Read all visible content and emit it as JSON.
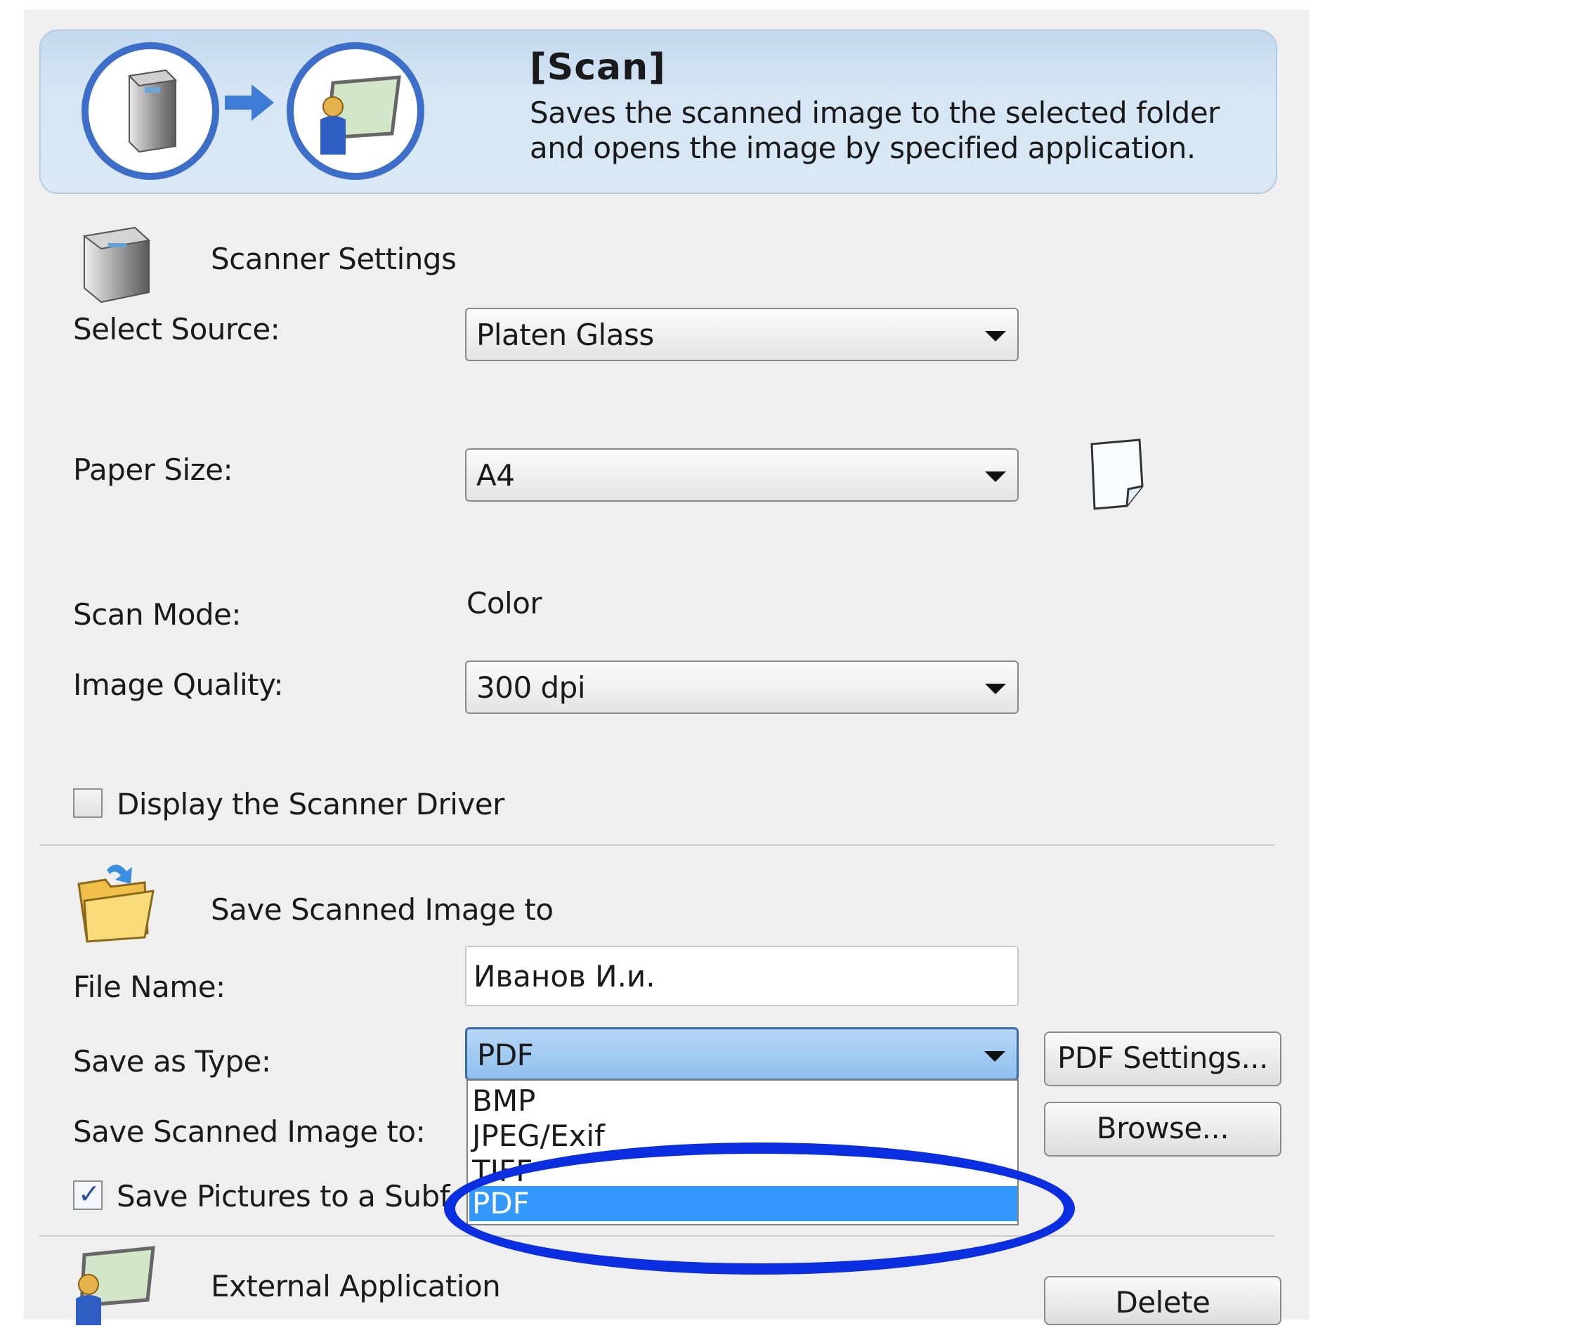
{
  "header": {
    "title": "[Scan]",
    "description_line1": "Saves the scanned image to the selected folder",
    "description_line2": "and opens the image by specified application."
  },
  "scanner_settings": {
    "section_title": "Scanner Settings",
    "source_label": "Select Source:",
    "source_value": "Platen Glass",
    "paper_size_label": "Paper Size:",
    "paper_size_value": "A4",
    "scan_mode_label": "Scan Mode:",
    "scan_mode_value": "Color",
    "image_quality_label": "Image Quality:",
    "image_quality_value": "300 dpi",
    "display_driver_label": "Display the Scanner Driver",
    "display_driver_checked": false
  },
  "save_section": {
    "section_title": "Save Scanned Image to",
    "file_name_label": "File Name:",
    "file_name_value": "Иванов И.и.",
    "save_as_type_label": "Save as Type:",
    "save_as_type_value": "PDF",
    "pdf_settings_button": "PDF Settings...",
    "save_to_label": "Save Scanned Image to:",
    "browse_button": "Browse...",
    "subfolder_label": "Save Pictures to a Subf",
    "subfolder_checked": true,
    "type_options": [
      "BMP",
      "JPEG/Exif",
      "TIFF",
      "PDF"
    ],
    "selected_option": "PDF"
  },
  "external_app": {
    "section_title": "External Application",
    "delete_button": "Delete"
  },
  "colors": {
    "banner_blue": "#cfe1f2",
    "ring_blue": "#3d6ec9",
    "selection_blue": "#3399ff",
    "highlight_blue": "#0b2fe0"
  }
}
